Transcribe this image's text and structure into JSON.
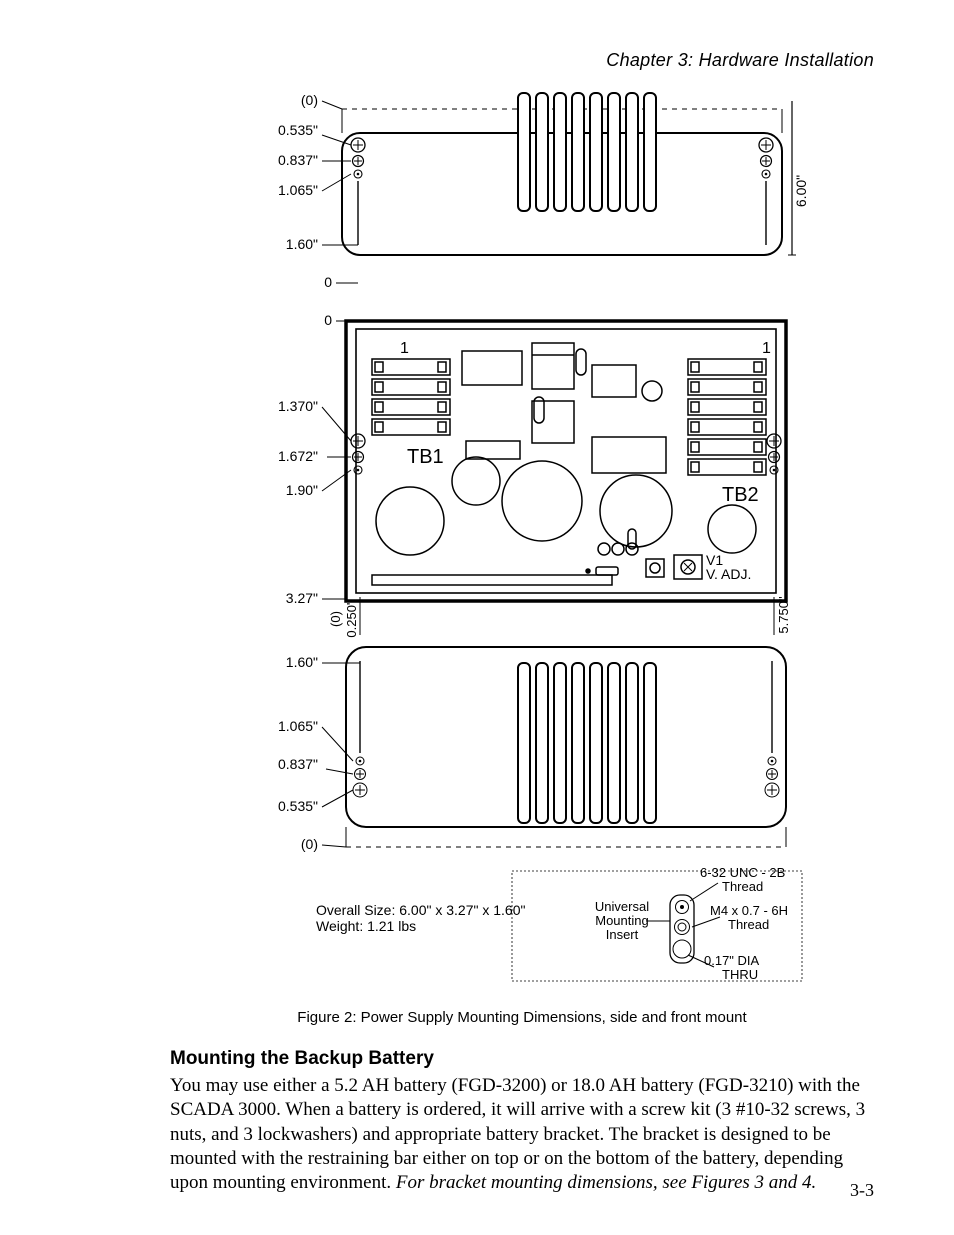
{
  "header": {
    "chapter": "Chapter 3: Hardware Installation"
  },
  "figure": {
    "caption": "Figure 2: Power Supply Mounting Dimensions, side and front mount",
    "dims_left_top_block": [
      "(0)",
      "0.535\"",
      "0.837\"",
      "1.065\"",
      "1.60\""
    ],
    "dims_left_mid_block": [
      "0",
      "0",
      "1.370\"",
      "1.672\"",
      "1.90\""
    ],
    "dims_left_bottom_block": [
      "3.27\"",
      "1.60\"",
      "1.065\"",
      "0.837\"",
      "0.535\"",
      "(0)"
    ],
    "dim_right_vert_top": "6.00\"",
    "dim_right_vert_mid": "5.750\"",
    "dim_bottom_small": "0.250\"",
    "board_labels": {
      "tb1": "TB1",
      "tb2": "TB2",
      "v1a": "V1",
      "v1b": "V. ADJ."
    },
    "overall": {
      "line1": "Overall Size: 6.00\" x 3.27\" x 1.60\"",
      "line2": "Weight: 1.21 lbs"
    },
    "insert": {
      "title1": "Universal",
      "title2": "Mounting",
      "title3": "Insert",
      "note1a": "6-32 UNC - 2B",
      "note1b": "Thread",
      "note2a": "M4 x 0.7 - 6H",
      "note2b": "Thread",
      "note3a": "0.17\" DIA",
      "note3b": "THRU"
    }
  },
  "section": {
    "heading": "Mounting the Backup Battery",
    "paragraph": "You may use either a 5.2 AH battery (FGD-3200) or 18.0 AH battery (FGD-3210) with the SCADA 3000.  When a battery is ordered, it will arrive with a screw kit (3 #10-32 screws, 3 nuts, and 3 lockwashers) and appropriate battery bracket. The bracket is designed to be mounted with the restraining bar either on top or on the bottom of the battery, depending upon mounting environment. ",
    "paragraph_italic": "For bracket mounting dimensions, see Figures 3 and 4."
  },
  "page_number": "3-3",
  "chart_data": {
    "type": "technical-diagram",
    "title": "Power Supply Mounting Dimensions, side and front mount",
    "overall_size_in": {
      "width": 6.0,
      "depth": 3.27,
      "height": 1.6
    },
    "weight_lbs": 1.21,
    "side_view_hole_offsets_in": [
      0,
      0.535,
      0.837,
      1.065,
      1.6
    ],
    "front_view_hole_offsets_in": [
      0,
      1.37,
      1.672,
      1.9
    ],
    "front_view_total_width_in": 6.0,
    "bottom_view_width_in": 5.75,
    "bottom_edge_offset_in": 0.25,
    "bottom_view_height_in": 3.27,
    "universal_mounting_insert": {
      "thread_imperial": "6-32 UNC - 2B",
      "thread_metric": "M4 x 0.7 - 6H",
      "through_hole_dia_in": 0.17
    },
    "terminal_blocks": [
      "TB1",
      "TB2"
    ],
    "adjustment": "V1 V. ADJ."
  }
}
